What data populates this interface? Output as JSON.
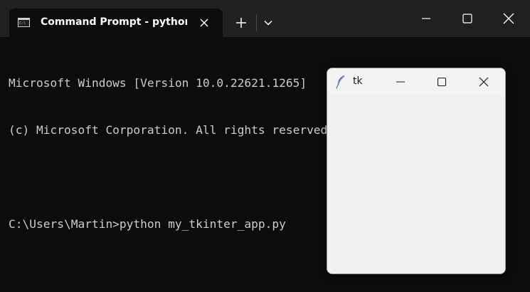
{
  "tab": {
    "title": "Command Prompt - python my_tkinter_app.py",
    "icon": "command-prompt-icon"
  },
  "titlebar_icons": {
    "new_tab": "plus-icon",
    "dropdown": "chevron-down-icon",
    "minimize": "minimize-icon",
    "maximize": "maximize-icon",
    "close": "close-icon"
  },
  "console": {
    "lines": [
      "Microsoft Windows [Version 10.0.22621.1265]",
      "(c) Microsoft Corporation. All rights reserved.",
      "",
      "C:\\Users\\Martin>python my_tkinter_app.py"
    ]
  },
  "tk_window": {
    "title": "tk",
    "icon": "feather-icon"
  },
  "colors": {
    "terminal_bg": "#0c0c0c",
    "titlebar_bg": "#202020",
    "console_text": "#cccccc",
    "tk_bg": "#f0f0f0"
  }
}
